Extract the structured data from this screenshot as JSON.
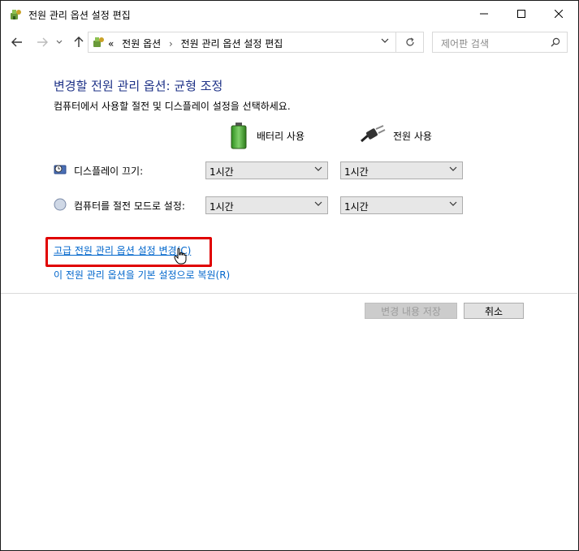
{
  "window": {
    "title": "전원 관리 옵션 설정 편집",
    "icon": "power-options-icon"
  },
  "nav": {
    "breadcrumb_overflow": "«",
    "breadcrumbs": [
      "전원 옵션",
      "전원 관리 옵션 설정 편집"
    ],
    "search_placeholder": "제어판 검색"
  },
  "content": {
    "heading": "변경할 전원 관리 옵션: 균형 조정",
    "subtitle": "컴퓨터에서 사용할 절전 및 디스플레이 설정을 선택하세요.",
    "columns": {
      "battery": "배터리 사용",
      "plugged": "전원 사용"
    },
    "rows": [
      {
        "label": "디스플레이 끄기:",
        "battery": "1시간",
        "plugged": "1시간"
      },
      {
        "label": "컴퓨터를 절전 모드로 설정:",
        "battery": "1시간",
        "plugged": "1시간"
      }
    ],
    "advanced_link": "고급 전원 관리 옵션 설정 변경(C)",
    "restore_link": "이 전원 관리 옵션을 기본 설정으로 복원(R)"
  },
  "footer": {
    "save_label": "변경 내용 저장",
    "cancel_label": "취소"
  },
  "colors": {
    "heading": "#1e3287",
    "link": "#0066cc",
    "highlight": "#e00000"
  }
}
